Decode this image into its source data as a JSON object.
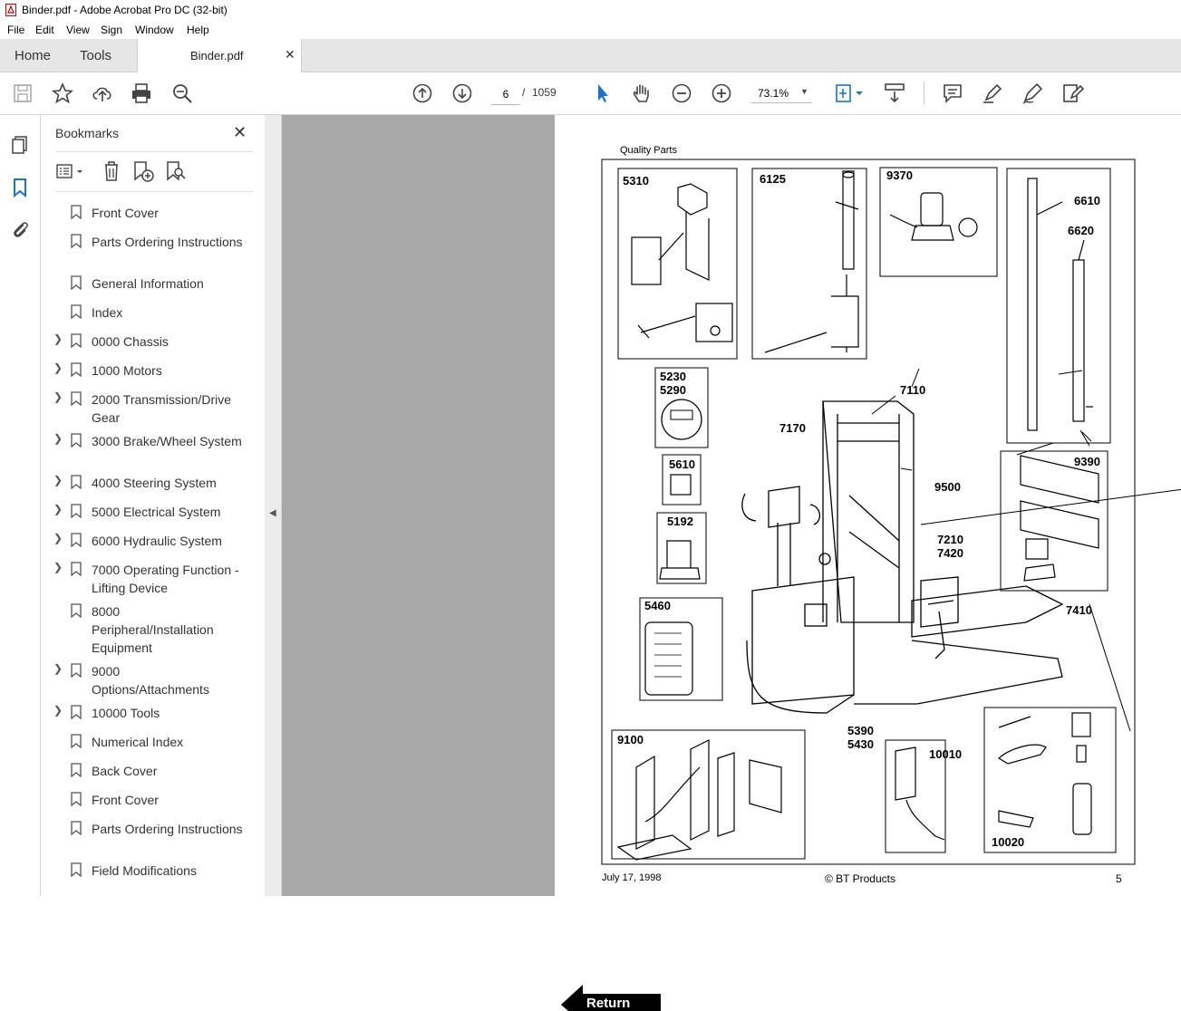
{
  "window": {
    "title": "Binder.pdf - Adobe Acrobat Pro DC (32-bit)"
  },
  "menu": [
    "File",
    "Edit",
    "View",
    "Sign",
    "Window",
    "Help"
  ],
  "tabs": {
    "home": "Home",
    "tools": "Tools",
    "document": "Binder.pdf"
  },
  "toolbar": {
    "current_page": "6",
    "page_separator": "/",
    "total_pages": "1059",
    "zoom": "73.1%"
  },
  "bookmarks": {
    "title": "Bookmarks",
    "items": [
      {
        "label": "Front Cover",
        "expandable": false
      },
      {
        "label": "Parts Ordering Instructions",
        "expandable": false
      },
      {
        "label": "General Information",
        "expandable": false
      },
      {
        "label": "Index",
        "expandable": false
      },
      {
        "label": "0000 Chassis",
        "expandable": true
      },
      {
        "label": "1000 Motors",
        "expandable": true
      },
      {
        "label": "2000 Transmission/Drive Gear",
        "expandable": true
      },
      {
        "label": "3000 Brake/Wheel System",
        "expandable": true
      },
      {
        "label": "4000 Steering System",
        "expandable": true
      },
      {
        "label": "5000 Electrical System",
        "expandable": true
      },
      {
        "label": "6000 Hydraulic System",
        "expandable": true
      },
      {
        "label": "7000 Operating Function - Lifting Device",
        "expandable": true
      },
      {
        "label": "8000 Peripheral/Installation Equipment",
        "expandable": false
      },
      {
        "label": "9000 Options/Attachments",
        "expandable": true
      },
      {
        "label": "10000 Tools",
        "expandable": true
      },
      {
        "label": "Numerical Index",
        "expandable": false
      },
      {
        "label": "Back Cover",
        "expandable": false
      },
      {
        "label": "Front Cover",
        "expandable": false
      },
      {
        "label": "Parts Ordering Instructions",
        "expandable": false
      },
      {
        "label": "Field Modifications",
        "expandable": false
      }
    ]
  },
  "document": {
    "header": "Quality Parts",
    "part_labels": [
      "5310",
      "6125",
      "9370",
      "6610",
      "6620",
      "5230",
      "5290",
      "7110",
      "7170",
      "5610",
      "9500",
      "9390",
      "5192",
      "7210",
      "7420",
      "7410",
      "5460",
      "9100",
      "5390",
      "5430",
      "10010",
      "10020"
    ],
    "footer_left": "July 17, 1998",
    "footer_center": "© BT Products",
    "footer_right": "5",
    "return_button": "Return"
  },
  "colors": {
    "accent_blue": "#1a73c8",
    "doc_background": "#a8a8a8"
  }
}
